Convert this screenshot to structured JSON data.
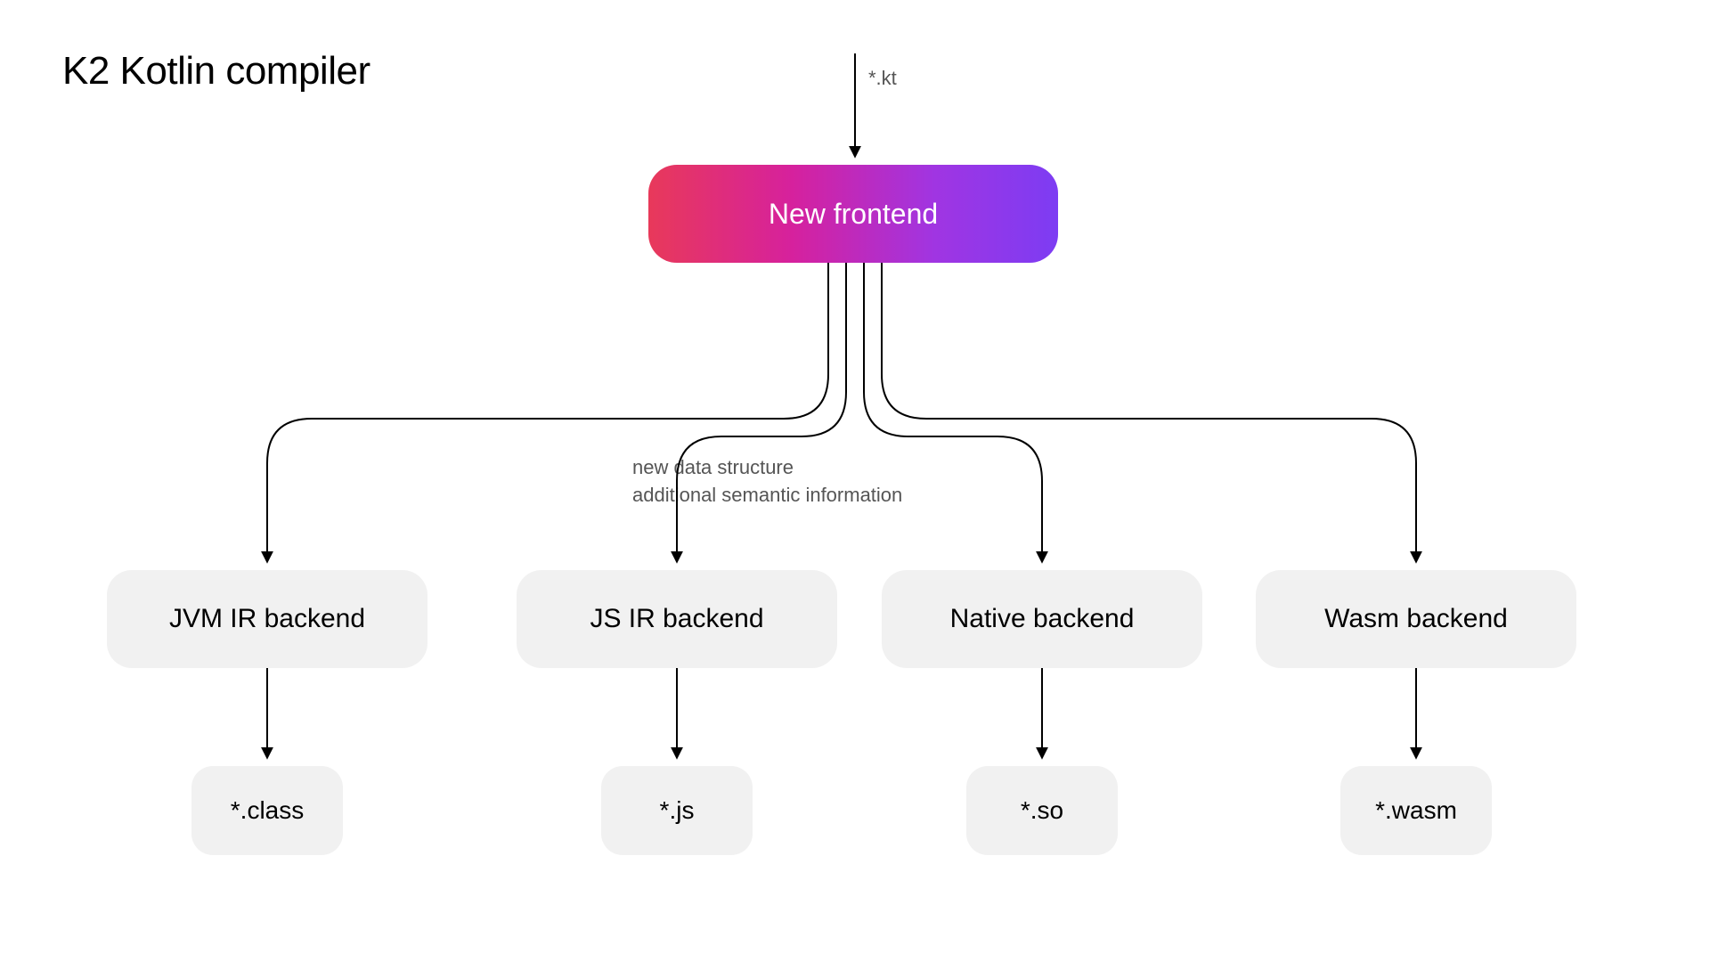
{
  "title": "K2 Kotlin compiler",
  "input": "*.kt",
  "frontend": "New frontend",
  "annotation_line1": "new data structure",
  "annotation_line2": "additional semantic information",
  "backends": [
    {
      "label": "JVM IR backend",
      "output": "*.class"
    },
    {
      "label": "JS IR backend",
      "output": "*.js"
    },
    {
      "label": "Native backend",
      "output": "*.so"
    },
    {
      "label": "Wasm backend",
      "output": "*.wasm"
    }
  ],
  "chart_data": {
    "type": "flow-diagram",
    "title": "K2 Kotlin compiler",
    "nodes": [
      {
        "id": "input",
        "label": "*.kt",
        "kind": "input"
      },
      {
        "id": "frontend",
        "label": "New frontend",
        "kind": "stage",
        "note": "new data structure; additional semantic information"
      },
      {
        "id": "jvm",
        "label": "JVM IR backend",
        "kind": "backend"
      },
      {
        "id": "js",
        "label": "JS IR backend",
        "kind": "backend"
      },
      {
        "id": "native",
        "label": "Native backend",
        "kind": "backend"
      },
      {
        "id": "wasm",
        "label": "Wasm backend",
        "kind": "backend"
      },
      {
        "id": "out_jvm",
        "label": "*.class",
        "kind": "output"
      },
      {
        "id": "out_js",
        "label": "*.js",
        "kind": "output"
      },
      {
        "id": "out_nat",
        "label": "*.so",
        "kind": "output"
      },
      {
        "id": "out_wasm",
        "label": "*.wasm",
        "kind": "output"
      }
    ],
    "edges": [
      [
        "input",
        "frontend"
      ],
      [
        "frontend",
        "jvm"
      ],
      [
        "frontend",
        "js"
      ],
      [
        "frontend",
        "native"
      ],
      [
        "frontend",
        "wasm"
      ],
      [
        "jvm",
        "out_jvm"
      ],
      [
        "js",
        "out_js"
      ],
      [
        "native",
        "out_nat"
      ],
      [
        "wasm",
        "out_wasm"
      ]
    ]
  }
}
